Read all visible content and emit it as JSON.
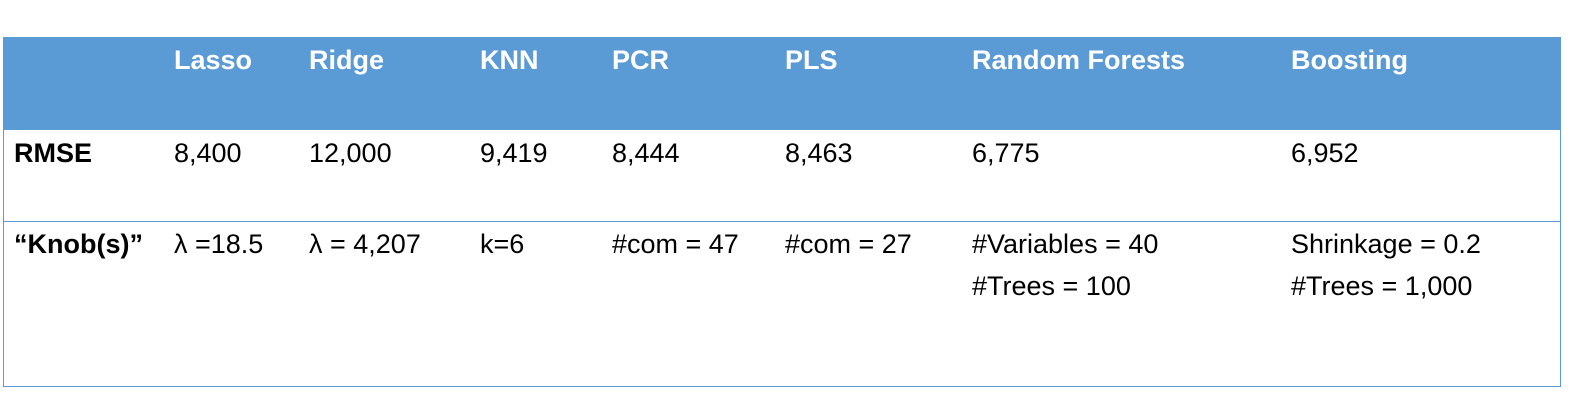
{
  "table": {
    "headers": [
      "",
      "Lasso",
      "Ridge",
      "KNN",
      "PCR",
      "PLS",
      "Random Forests",
      "Boosting"
    ],
    "rows": [
      {
        "label": "RMSE",
        "cells": [
          [
            "8,400"
          ],
          [
            "12,000"
          ],
          [
            "9,419"
          ],
          [
            "8,444"
          ],
          [
            "8,463"
          ],
          [
            "6,775"
          ],
          [
            "6,952"
          ]
        ]
      },
      {
        "label": "“Knob(s)”",
        "cells": [
          [
            "λ =18.5"
          ],
          [
            "λ = 4,207"
          ],
          [
            "k=6"
          ],
          [
            "#com = 47"
          ],
          [
            "#com = 27"
          ],
          [
            "#Variables = 40",
            "#Trees = 100"
          ],
          [
            "Shrinkage = 0.2",
            "#Trees = 1,000"
          ]
        ]
      }
    ]
  },
  "colors": {
    "header_bg": "#5b9bd5",
    "header_text": "#ffffff",
    "border": "#5b9bd5"
  }
}
